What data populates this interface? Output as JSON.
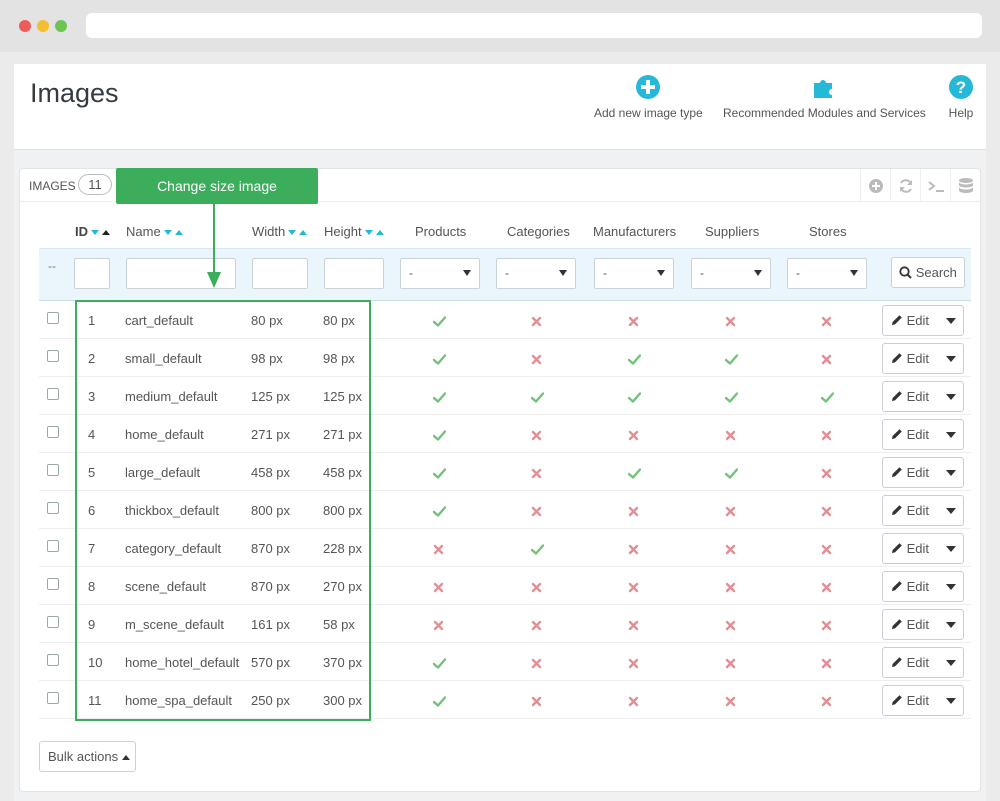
{
  "page": {
    "title": "Images"
  },
  "toolbar": {
    "add_label": "Add new image type",
    "modules_label": "Recommended Modules and Services",
    "help_label": "Help"
  },
  "panel": {
    "title": "IMAGES",
    "count": "11"
  },
  "callout": {
    "text": "Change size image"
  },
  "columns": {
    "id": "ID",
    "name": "Name",
    "width": "Width",
    "height": "Height",
    "products": "Products",
    "categories": "Categories",
    "manufacturers": "Manufacturers",
    "suppliers": "Suppliers",
    "stores": "Stores"
  },
  "filters": {
    "dash": "--",
    "select_value": "-",
    "search_label": "Search"
  },
  "colors": {
    "check": "#72c279",
    "cross": "#e08f95",
    "accent": "#25b9d7",
    "callout": "#3cae5b"
  },
  "rows": [
    {
      "id": "1",
      "name": "cart_default",
      "width": "80 px",
      "height": "80 px",
      "products": true,
      "categories": false,
      "manufacturers": false,
      "suppliers": false,
      "stores": false
    },
    {
      "id": "2",
      "name": "small_default",
      "width": "98 px",
      "height": "98 px",
      "products": true,
      "categories": false,
      "manufacturers": true,
      "suppliers": true,
      "stores": false
    },
    {
      "id": "3",
      "name": "medium_default",
      "width": "125 px",
      "height": "125 px",
      "products": true,
      "categories": true,
      "manufacturers": true,
      "suppliers": true,
      "stores": true
    },
    {
      "id": "4",
      "name": "home_default",
      "width": "271 px",
      "height": "271 px",
      "products": true,
      "categories": false,
      "manufacturers": false,
      "suppliers": false,
      "stores": false
    },
    {
      "id": "5",
      "name": "large_default",
      "width": "458 px",
      "height": "458 px",
      "products": true,
      "categories": false,
      "manufacturers": true,
      "suppliers": true,
      "stores": false
    },
    {
      "id": "6",
      "name": "thickbox_default",
      "width": "800 px",
      "height": "800 px",
      "products": true,
      "categories": false,
      "manufacturers": false,
      "suppliers": false,
      "stores": false
    },
    {
      "id": "7",
      "name": "category_default",
      "width": "870 px",
      "height": "228 px",
      "products": false,
      "categories": true,
      "manufacturers": false,
      "suppliers": false,
      "stores": false
    },
    {
      "id": "8",
      "name": "scene_default",
      "width": "870 px",
      "height": "270 px",
      "products": false,
      "categories": false,
      "manufacturers": false,
      "suppliers": false,
      "stores": false
    },
    {
      "id": "9",
      "name": "m_scene_default",
      "width": "161 px",
      "height": "58 px",
      "products": false,
      "categories": false,
      "manufacturers": false,
      "suppliers": false,
      "stores": false
    },
    {
      "id": "10",
      "name": "home_hotel_default",
      "width": "570 px",
      "height": "370 px",
      "products": true,
      "categories": false,
      "manufacturers": false,
      "suppliers": false,
      "stores": false
    },
    {
      "id": "11",
      "name": "home_spa_default",
      "width": "250 px",
      "height": "300 px",
      "products": true,
      "categories": false,
      "manufacturers": false,
      "suppliers": false,
      "stores": false
    }
  ],
  "row_actions": {
    "edit_label": "Edit"
  },
  "footer": {
    "bulk_label": "Bulk actions"
  }
}
